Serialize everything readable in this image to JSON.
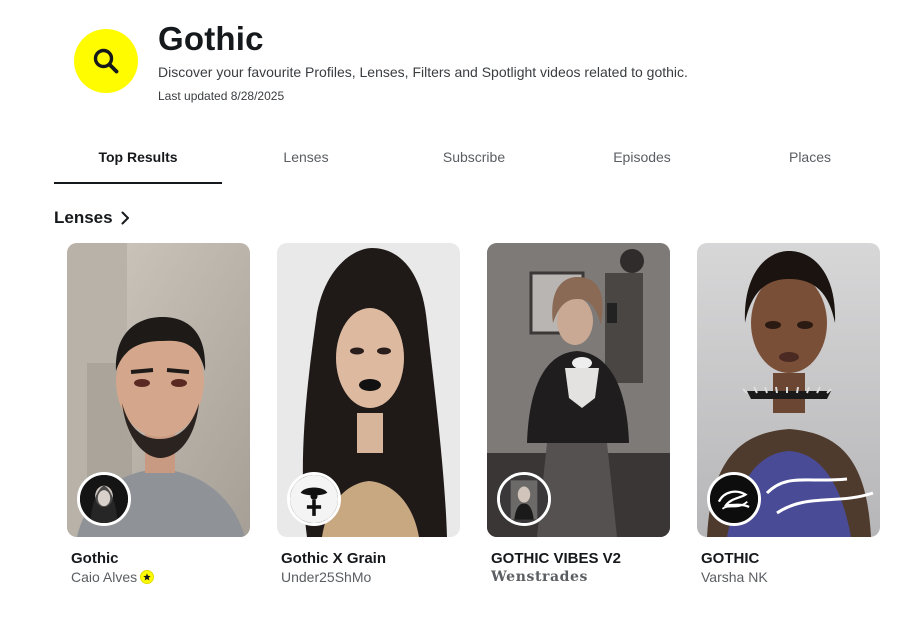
{
  "header": {
    "title": "Gothic",
    "subtitle": "Discover your favourite Profiles, Lenses, Filters and Spotlight videos related to gothic.",
    "last_updated": "Last updated 8/28/2025",
    "badge_icon": "search-icon",
    "badge_color": "#fffc00"
  },
  "tabs": [
    {
      "label": "Top Results",
      "active": true
    },
    {
      "label": "Lenses",
      "active": false
    },
    {
      "label": "Subscribe",
      "active": false
    },
    {
      "label": "Episodes",
      "active": false
    },
    {
      "label": "Places",
      "active": false
    }
  ],
  "section": {
    "title": "Lenses",
    "icon": "chevron-right-icon"
  },
  "lenses": [
    {
      "title": "Gothic",
      "creator": "Caio Alves",
      "verified": true
    },
    {
      "title": "Gothic X Grain",
      "creator": "Under25ShMo",
      "verified": false
    },
    {
      "title": "GOTHIC VIBES V2",
      "creator": "Wenstrades",
      "verified": false
    },
    {
      "title": "GOTHIC",
      "creator": "Varsha NK",
      "verified": false
    }
  ]
}
